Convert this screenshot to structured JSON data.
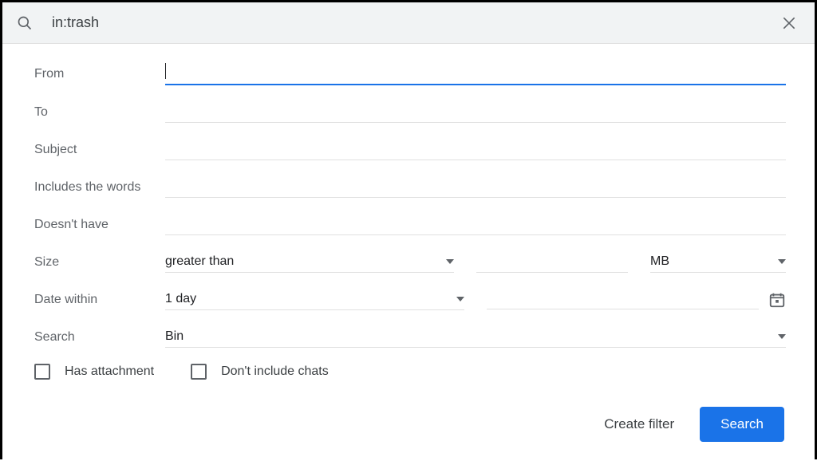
{
  "search_bar": {
    "query": "in:trash"
  },
  "labels": {
    "from": "From",
    "to": "To",
    "subject": "Subject",
    "includes": "Includes the words",
    "doesnt_have": "Doesn't have",
    "size": "Size",
    "date_within": "Date within",
    "search": "Search"
  },
  "fields": {
    "from": "",
    "to": "",
    "subject": "",
    "includes": "",
    "doesnt_have": "",
    "size_value": ""
  },
  "selects": {
    "size_comparator": "greater than",
    "size_unit": "MB",
    "date_within": "1 day",
    "search_in": "Bin"
  },
  "checkbox": {
    "has_attachment": "Has attachment",
    "dont_include_chats": "Don't include chats"
  },
  "actions": {
    "create_filter": "Create filter",
    "search": "Search"
  }
}
